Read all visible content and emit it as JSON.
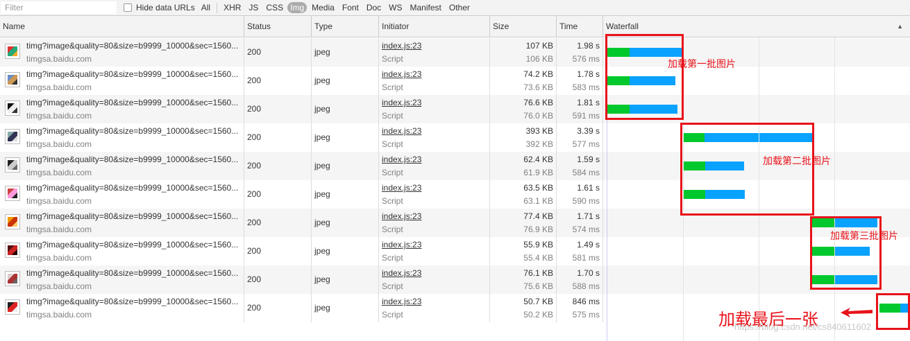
{
  "toolbar": {
    "filter_placeholder": "Filter",
    "hide_data_urls": "Hide data URLs",
    "types": [
      "All",
      "XHR",
      "JS",
      "CSS",
      "Img",
      "Media",
      "Font",
      "Doc",
      "WS",
      "Manifest",
      "Other"
    ],
    "active_type": "Img"
  },
  "columns": {
    "name": "Name",
    "status": "Status",
    "type": "Type",
    "initiator": "Initiator",
    "size": "Size",
    "time": "Time",
    "waterfall": "Waterfall",
    "sort_icon": "▲"
  },
  "rows": [
    {
      "name": "timg?image&quality=80&size=b9999_10000&sec=1560...",
      "domain": "timgsa.baidu.com",
      "status": "200",
      "type": "jpeg",
      "initiator": "index.js:23",
      "initiator_type": "Script",
      "size": "107 KB",
      "resource_size": "106 KB",
      "time": "1.98 s",
      "latency": "576 ms"
    },
    {
      "name": "timg?image&quality=80&size=b9999_10000&sec=1560...",
      "domain": "timgsa.baidu.com",
      "status": "200",
      "type": "jpeg",
      "initiator": "index.js:23",
      "initiator_type": "Script",
      "size": "74.2 KB",
      "resource_size": "73.6 KB",
      "time": "1.78 s",
      "latency": "583 ms"
    },
    {
      "name": "timg?image&quality=80&size=b9999_10000&sec=1560...",
      "domain": "timgsa.baidu.com",
      "status": "200",
      "type": "jpeg",
      "initiator": "index.js:23",
      "initiator_type": "Script",
      "size": "76.6 KB",
      "resource_size": "76.0 KB",
      "time": "1.81 s",
      "latency": "591 ms"
    },
    {
      "name": "timg?image&quality=80&size=b9999_10000&sec=1560...",
      "domain": "timgsa.baidu.com",
      "status": "200",
      "type": "jpeg",
      "initiator": "index.js:23",
      "initiator_type": "Script",
      "size": "393 KB",
      "resource_size": "392 KB",
      "time": "3.39 s",
      "latency": "577 ms"
    },
    {
      "name": "timg?image&quality=80&size=b9999_10000&sec=1560...",
      "domain": "timgsa.baidu.com",
      "status": "200",
      "type": "jpeg",
      "initiator": "index.js:23",
      "initiator_type": "Script",
      "size": "62.4 KB",
      "resource_size": "61.9 KB",
      "time": "1.59 s",
      "latency": "584 ms"
    },
    {
      "name": "timg?image&quality=80&size=b9999_10000&sec=1560...",
      "domain": "timgsa.baidu.com",
      "status": "200",
      "type": "jpeg",
      "initiator": "index.js:23",
      "initiator_type": "Script",
      "size": "63.5 KB",
      "resource_size": "63.1 KB",
      "time": "1.61 s",
      "latency": "590 ms"
    },
    {
      "name": "timg?image&quality=80&size=b9999_10000&sec=1560...",
      "domain": "timgsa.baidu.com",
      "status": "200",
      "type": "jpeg",
      "initiator": "index.js:23",
      "initiator_type": "Script",
      "size": "77.4 KB",
      "resource_size": "76.9 KB",
      "time": "1.71 s",
      "latency": "574 ms"
    },
    {
      "name": "timg?image&quality=80&size=b9999_10000&sec=1560...",
      "domain": "timgsa.baidu.com",
      "status": "200",
      "type": "jpeg",
      "initiator": "index.js:23",
      "initiator_type": "Script",
      "size": "55.9 KB",
      "resource_size": "55.4 KB",
      "time": "1.49 s",
      "latency": "581 ms"
    },
    {
      "name": "timg?image&quality=80&size=b9999_10000&sec=1560...",
      "domain": "timgsa.baidu.com",
      "status": "200",
      "type": "jpeg",
      "initiator": "index.js:23",
      "initiator_type": "Script",
      "size": "76.1 KB",
      "resource_size": "75.6 KB",
      "time": "1.70 s",
      "latency": "588 ms"
    },
    {
      "name": "timg?image&quality=80&size=b9999_10000&sec=1560...",
      "domain": "timgsa.baidu.com",
      "status": "200",
      "type": "jpeg",
      "initiator": "index.js:23",
      "initiator_type": "Script",
      "size": "50.7 KB",
      "resource_size": "50.2 KB",
      "time": "846 ms",
      "latency": "575 ms"
    }
  ],
  "annotations": {
    "batch1": "加载第一批图片",
    "batch2": "加载第二批图片",
    "batch3": "加载第三批图片",
    "last": "加载最后一张"
  },
  "watermark": "https://blog.csdn.net/cs840611602",
  "colors": {
    "waiting": "#00c82d",
    "download": "#0aa2ff",
    "annotation": "#e8121a",
    "active_filter": "#aaaaaa"
  }
}
